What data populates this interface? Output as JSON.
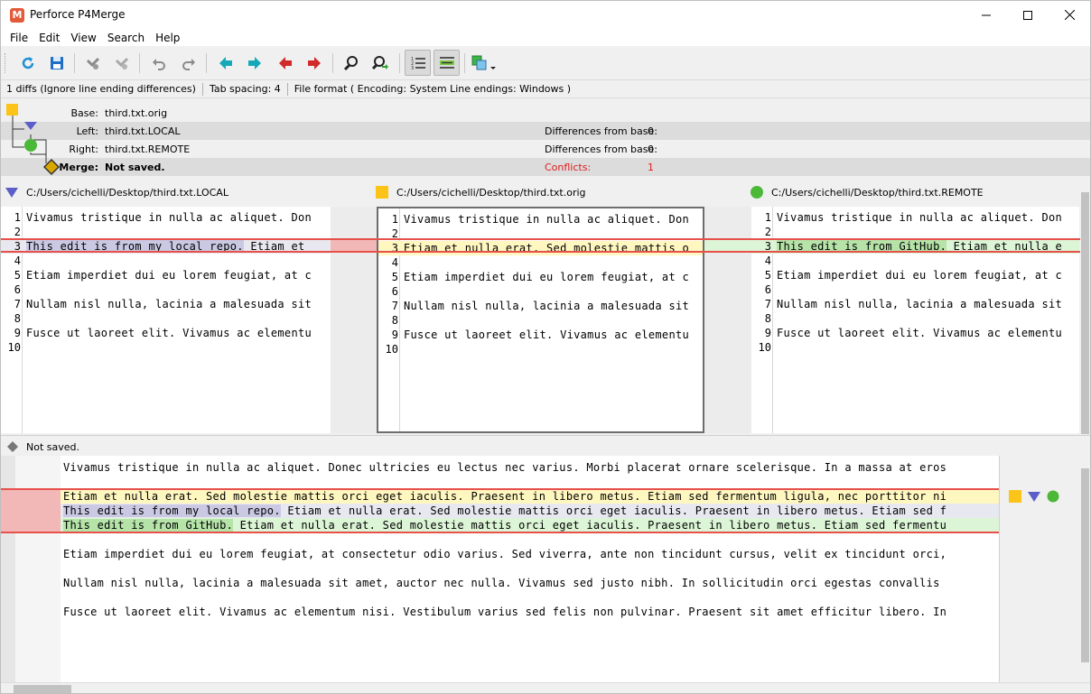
{
  "window": {
    "title": "Perforce P4Merge",
    "app_icon_letter": "M",
    "minimize_icon": "minimize-icon",
    "maximize_icon": "maximize-icon",
    "close_icon": "close-icon"
  },
  "menu": [
    "File",
    "Edit",
    "View",
    "Search",
    "Help"
  ],
  "toolbar": {
    "items": [
      "refresh-icon",
      "save-icon",
      "mark-icon",
      "unmark-icon",
      "undo-icon",
      "redo-icon",
      "prev-diff-icon",
      "next-diff-icon",
      "prev-conflict-icon",
      "next-conflict-icon",
      "find-icon",
      "find-next-icon",
      "line-numbers-icon",
      "show-diffs-icon",
      "layout-icon"
    ]
  },
  "status": {
    "diffs": "1 diffs (Ignore line ending differences)",
    "tab_spacing": "Tab spacing: 4",
    "file_format": "File format ( Encoding: System  Line endings: Windows )"
  },
  "files": {
    "base": {
      "label": "Base:",
      "name": "third.txt.orig"
    },
    "left": {
      "label": "Left:",
      "name": "third.txt.LOCAL",
      "diff_label": "Differences from base:",
      "diff_count": "0"
    },
    "right": {
      "label": "Right:",
      "name": "third.txt.REMOTE",
      "diff_label": "Differences from base:",
      "diff_count": "0"
    },
    "merge": {
      "label": "Merge:",
      "name": "Not saved.",
      "conflict_label": "Conflicts:",
      "conflict_count": "1"
    }
  },
  "colors": {
    "base": "#fcc419",
    "left": "#5c5fc8",
    "right": "#4cb838",
    "conflict": "#e03a3a",
    "highlight_yellow": "#fff7c0",
    "highlight_green": "#dcf5d6",
    "highlight_left": "#c9c9e4",
    "highlight_red": "#f2b8b8"
  },
  "panes": {
    "left": {
      "path": "C:/Users/cichelli/Desktop/third.txt.LOCAL",
      "lines": [
        {
          "n": "1",
          "text": "Vivamus tristique in nulla ac aliquet. Don"
        },
        {
          "n": "2",
          "text": ""
        },
        {
          "n": "3",
          "hl": "This edit is from my local repo.",
          "text": " Etiam et"
        },
        {
          "n": "4",
          "text": ""
        },
        {
          "n": "5",
          "text": "Etiam imperdiet dui eu lorem feugiat, at c"
        },
        {
          "n": "6",
          "text": ""
        },
        {
          "n": "7",
          "text": "Nullam nisl nulla, lacinia a malesuada sit"
        },
        {
          "n": "8",
          "text": ""
        },
        {
          "n": "9",
          "text": "Fusce ut laoreet elit. Vivamus ac elementu"
        },
        {
          "n": "10",
          "text": ""
        }
      ]
    },
    "base": {
      "path": "C:/Users/cichelli/Desktop/third.txt.orig",
      "lines": [
        {
          "n": "1",
          "text": "Vivamus tristique in nulla ac aliquet. Don"
        },
        {
          "n": "2",
          "text": ""
        },
        {
          "n": "3",
          "text": "Etiam et nulla erat. Sed molestie mattis o"
        },
        {
          "n": "4",
          "text": ""
        },
        {
          "n": "5",
          "text": "Etiam imperdiet dui eu lorem feugiat, at c"
        },
        {
          "n": "6",
          "text": ""
        },
        {
          "n": "7",
          "text": "Nullam nisl nulla, lacinia a malesuada sit"
        },
        {
          "n": "8",
          "text": ""
        },
        {
          "n": "9",
          "text": "Fusce ut laoreet elit. Vivamus ac elementu"
        },
        {
          "n": "10",
          "text": ""
        }
      ]
    },
    "right": {
      "path": "C:/Users/cichelli/Desktop/third.txt.REMOTE",
      "lines": [
        {
          "n": "1",
          "text": "Vivamus tristique in nulla ac aliquet. Don"
        },
        {
          "n": "2",
          "text": ""
        },
        {
          "n": "3",
          "hl": "This edit is from GitHub.",
          "text": " Etiam et nulla e"
        },
        {
          "n": "4",
          "text": ""
        },
        {
          "n": "5",
          "text": "Etiam imperdiet dui eu lorem feugiat, at c"
        },
        {
          "n": "6",
          "text": ""
        },
        {
          "n": "7",
          "text": "Nullam nisl nulla, lacinia a malesuada sit"
        },
        {
          "n": "8",
          "text": ""
        },
        {
          "n": "9",
          "text": "Fusce ut laoreet elit. Vivamus ac elementu"
        },
        {
          "n": "10",
          "text": ""
        }
      ]
    }
  },
  "merge": {
    "status": "Not saved.",
    "lines": [
      {
        "text": "Vivamus tristique in nulla ac aliquet. Donec ultricies eu lectus nec varius. Morbi placerat ornare scelerisque. In a massa at eros"
      },
      {
        "text": ""
      },
      {
        "src": "base",
        "text": "Etiam et nulla erat. Sed molestie mattis orci eget iaculis. Praesent in libero metus. Etiam sed fermentum ligula, nec porttitor ni"
      },
      {
        "src": "left",
        "hl": "This edit is from my local repo.",
        "text": " Etiam et nulla erat. Sed molestie mattis orci eget iaculis. Praesent in libero metus. Etiam sed f"
      },
      {
        "src": "right",
        "hl": "This edit is from GitHub.",
        "text": " Etiam et nulla erat. Sed molestie mattis orci eget iaculis. Praesent in libero metus. Etiam sed fermentu"
      },
      {
        "text": ""
      },
      {
        "text": "Etiam imperdiet dui eu lorem feugiat, at consectetur odio varius. Sed viverra, ante non tincidunt cursus, velit ex tincidunt orci,"
      },
      {
        "text": ""
      },
      {
        "text": "Nullam nisl nulla, lacinia a malesuada sit amet, auctor nec nulla. Vivamus sed justo nibh. In sollicitudin orci egestas convallis"
      },
      {
        "text": ""
      },
      {
        "text": "Fusce ut laoreet elit. Vivamus ac elementum nisi. Vestibulum varius sed felis non pulvinar. Praesent sit amet efficitur libero. In"
      }
    ]
  }
}
